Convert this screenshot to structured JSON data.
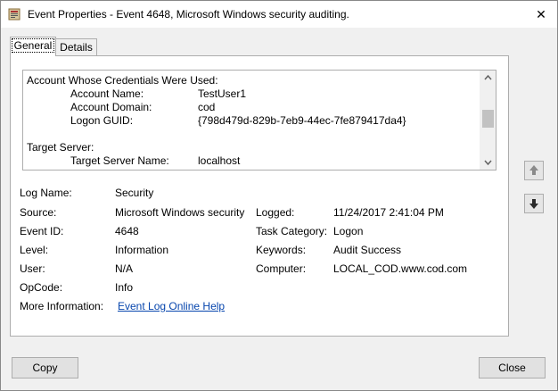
{
  "window": {
    "title": "Event Properties - Event 4648, Microsoft Windows security auditing.",
    "close_glyph": "✕"
  },
  "tabs": [
    {
      "label": "General",
      "selected": true
    },
    {
      "label": "Details",
      "selected": false
    }
  ],
  "description": {
    "lines": [
      {
        "text": "Account Whose Credentials Were Used:"
      },
      {
        "label": "Account Name:",
        "value": "TestUser1"
      },
      {
        "label": "Account Domain:",
        "value": "cod"
      },
      {
        "label": "Logon GUID:",
        "value": "{798d479d-829b-7eb9-44ec-7fe879417da4}"
      },
      {
        "text": ""
      },
      {
        "text": "Target Server:"
      },
      {
        "label": "Target Server Name:",
        "value": "localhost"
      }
    ]
  },
  "fields": {
    "log_name": {
      "label": "Log Name:",
      "value": "Security"
    },
    "source": {
      "label": "Source:",
      "value": "Microsoft Windows security"
    },
    "logged": {
      "label": "Logged:",
      "value": "11/24/2017 2:41:04 PM"
    },
    "event_id": {
      "label": "Event ID:",
      "value": "4648"
    },
    "task_category": {
      "label": "Task Category:",
      "value": "Logon"
    },
    "level": {
      "label": "Level:",
      "value": "Information"
    },
    "keywords": {
      "label": "Keywords:",
      "value": "Audit Success"
    },
    "user": {
      "label": "User:",
      "value": "N/A"
    },
    "computer": {
      "label": "Computer:",
      "value": "LOCAL_COD.www.cod.com"
    },
    "opcode": {
      "label": "OpCode:",
      "value": "Info"
    },
    "more_info": {
      "label": "More Information:",
      "link": "Event Log Online Help"
    }
  },
  "buttons": {
    "copy": "Copy",
    "close": "Close"
  },
  "colors": {
    "link": "#0645ad",
    "button_bg": "#e1e1e1",
    "border": "#adadad"
  }
}
